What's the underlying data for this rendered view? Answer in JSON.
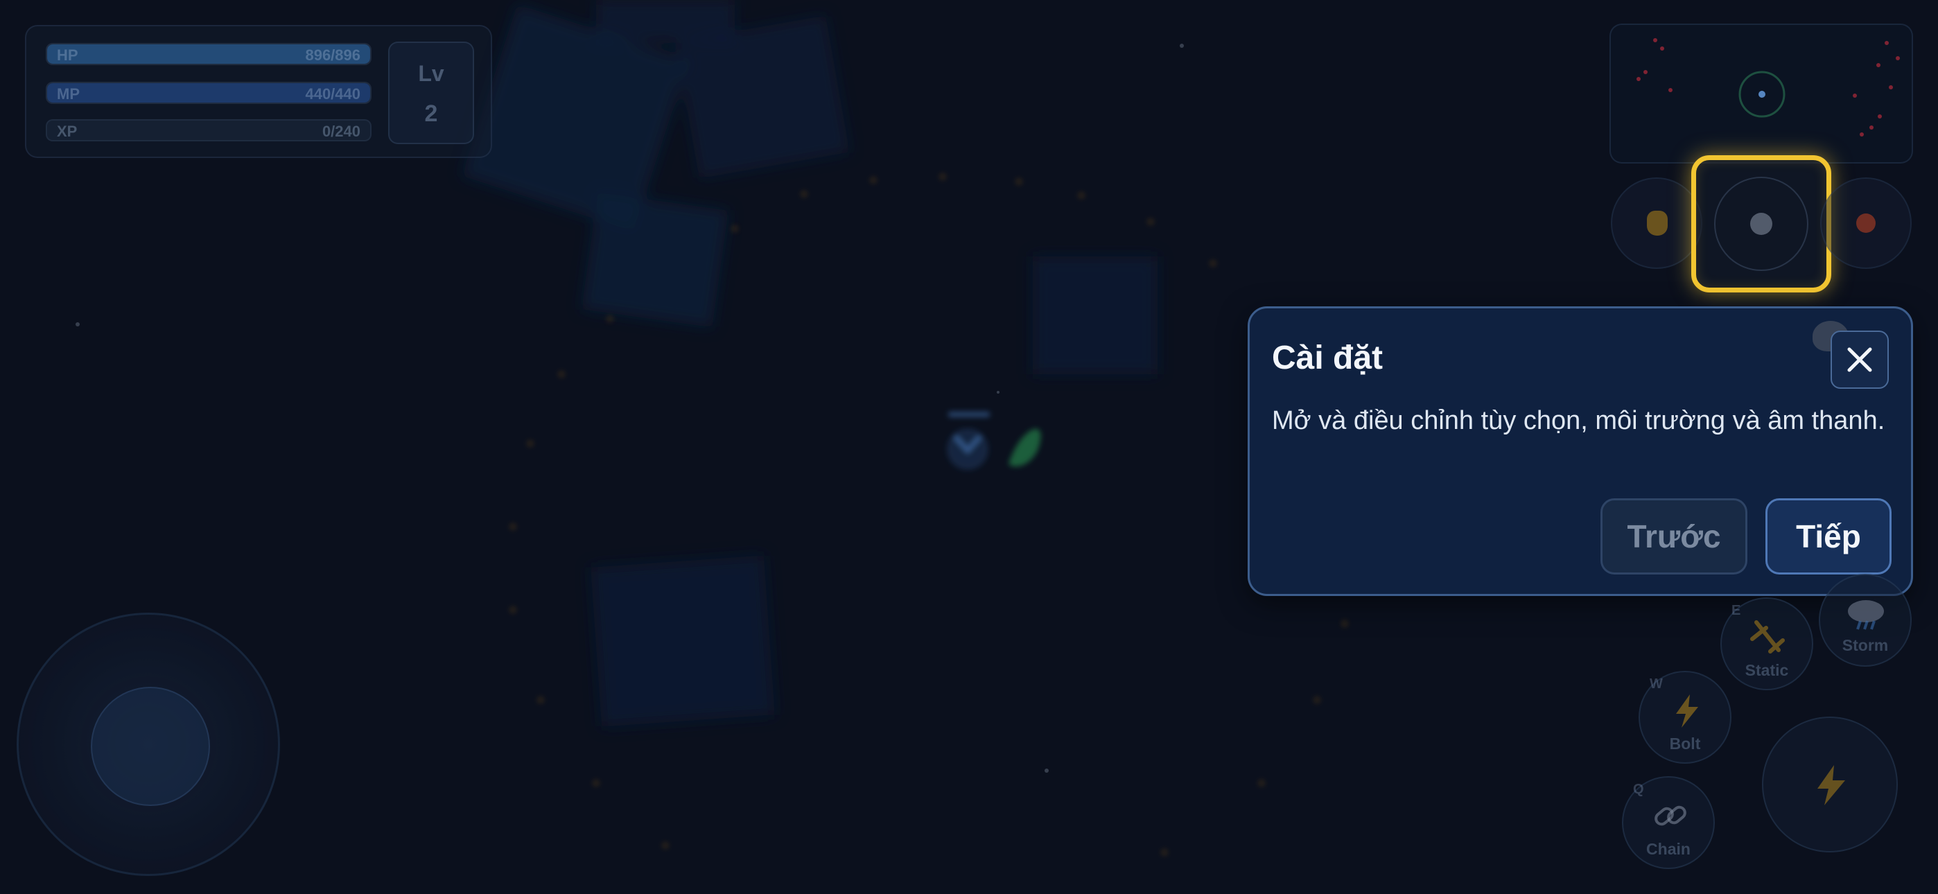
{
  "hud": {
    "hp": {
      "label": "HP",
      "value": "896/896",
      "fill_fraction": 1.0,
      "color": "#2f6fb0"
    },
    "mp": {
      "label": "MP",
      "value": "440/440",
      "fill_fraction": 1.0,
      "color": "#24509a"
    },
    "xp": {
      "label": "XP",
      "value": "0/240",
      "fill_fraction": 0.0,
      "color": "#2a3850"
    },
    "level": {
      "label": "Lv",
      "value": "2"
    }
  },
  "mode_buttons": [
    {
      "name": "hand-mode",
      "icon": "hand-icon",
      "color": "#c79a2a"
    },
    {
      "name": "settings-mode",
      "icon": "dot-icon",
      "color": "#8c96a5",
      "focused": true
    },
    {
      "name": "record-mode",
      "icon": "record-icon",
      "color": "#b84a2e"
    }
  ],
  "dialog": {
    "title": "Cài đặt",
    "body": "Mở và điều chỉnh tùy chọn, môi trường và âm thanh.",
    "prev_label": "Trước",
    "next_label": "Tiếp",
    "close_icon": "close-icon"
  },
  "skills": [
    {
      "key": "E",
      "name": "Static",
      "icon": "static-icon"
    },
    {
      "key": "",
      "name": "Storm",
      "icon": "storm-icon"
    },
    {
      "key": "W",
      "name": "Bolt",
      "icon": "bolt-icon"
    },
    {
      "key": "Q",
      "name": "Chain",
      "icon": "chain-icon"
    },
    {
      "key": "",
      "name": "",
      "icon": "lightning-attack-icon"
    }
  ],
  "colors": {
    "background": "#0d1321",
    "highlight": "#f2c531",
    "dialog_bg": "#0f2140",
    "accent_blue": "#4f78b6"
  }
}
